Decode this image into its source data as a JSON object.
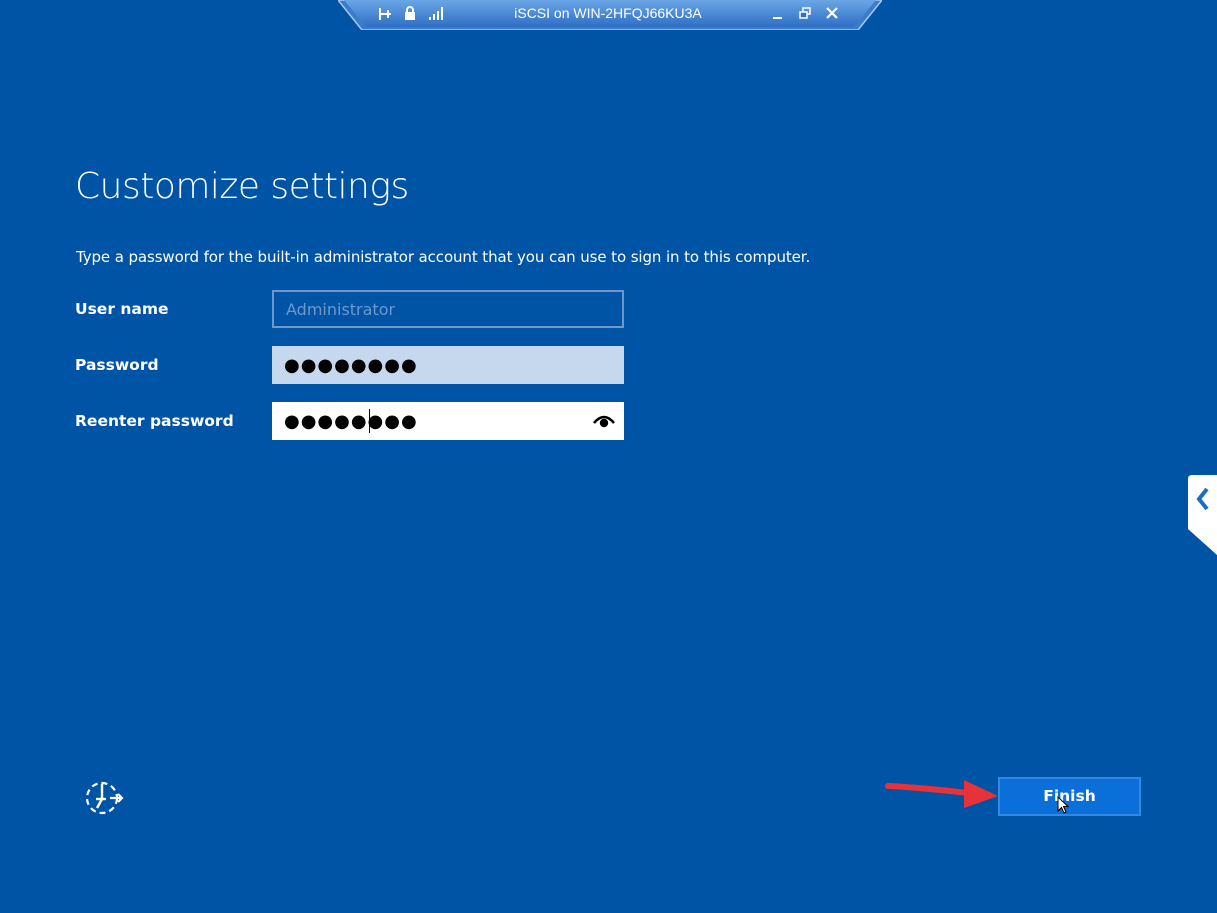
{
  "connection_bar": {
    "title": "iSCSI on WIN-2HFQJ66KU3A",
    "icons": [
      "pin-icon",
      "lock-icon",
      "signal-icon",
      "minimize-icon",
      "restore-icon",
      "close-icon"
    ]
  },
  "page": {
    "title": "Customize settings",
    "instructions": "Type a password for the built-in administrator account that you can use to sign in to this computer."
  },
  "form": {
    "user_name": {
      "label": "User name",
      "placeholder": "Administrator",
      "value": ""
    },
    "password": {
      "label": "Password",
      "value": "●●●●●●●●"
    },
    "reenter_password": {
      "label": "Reenter password",
      "value": "●●●●●●●●"
    }
  },
  "footer": {
    "finish_label": "Finish",
    "ease_of_access_icon": "ease-of-access-icon"
  },
  "colors": {
    "background": "#0054a6",
    "button": "#0a6fd8",
    "annotation_arrow": "#e8323a"
  }
}
